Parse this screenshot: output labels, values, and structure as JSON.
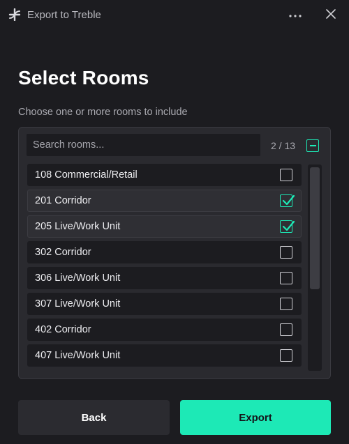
{
  "window": {
    "title": "Export to Treble",
    "icons": {
      "logo": "treble-logo-icon",
      "more": "more-horizontal-icon",
      "close": "close-icon"
    }
  },
  "page": {
    "title": "Select Rooms",
    "subtitle": "Choose one or more rooms to include"
  },
  "search": {
    "placeholder": "Search rooms...",
    "value": ""
  },
  "selection": {
    "count_text": "2 / 13",
    "select_all_state": "indeterminate"
  },
  "rooms": [
    {
      "label": "108 Commercial/Retail",
      "checked": false
    },
    {
      "label": "201 Corridor",
      "checked": true
    },
    {
      "label": "205 Live/Work Unit",
      "checked": true
    },
    {
      "label": "302 Corridor",
      "checked": false
    },
    {
      "label": "306 Live/Work Unit",
      "checked": false
    },
    {
      "label": "307 Live/Work Unit",
      "checked": false
    },
    {
      "label": "402 Corridor",
      "checked": false
    },
    {
      "label": "407 Live/Work Unit",
      "checked": false
    }
  ],
  "buttons": {
    "back": "Back",
    "export": "Export"
  },
  "colors": {
    "accent": "#1de9b6",
    "background": "#1c1c20",
    "panel": "#2a2a2f"
  }
}
